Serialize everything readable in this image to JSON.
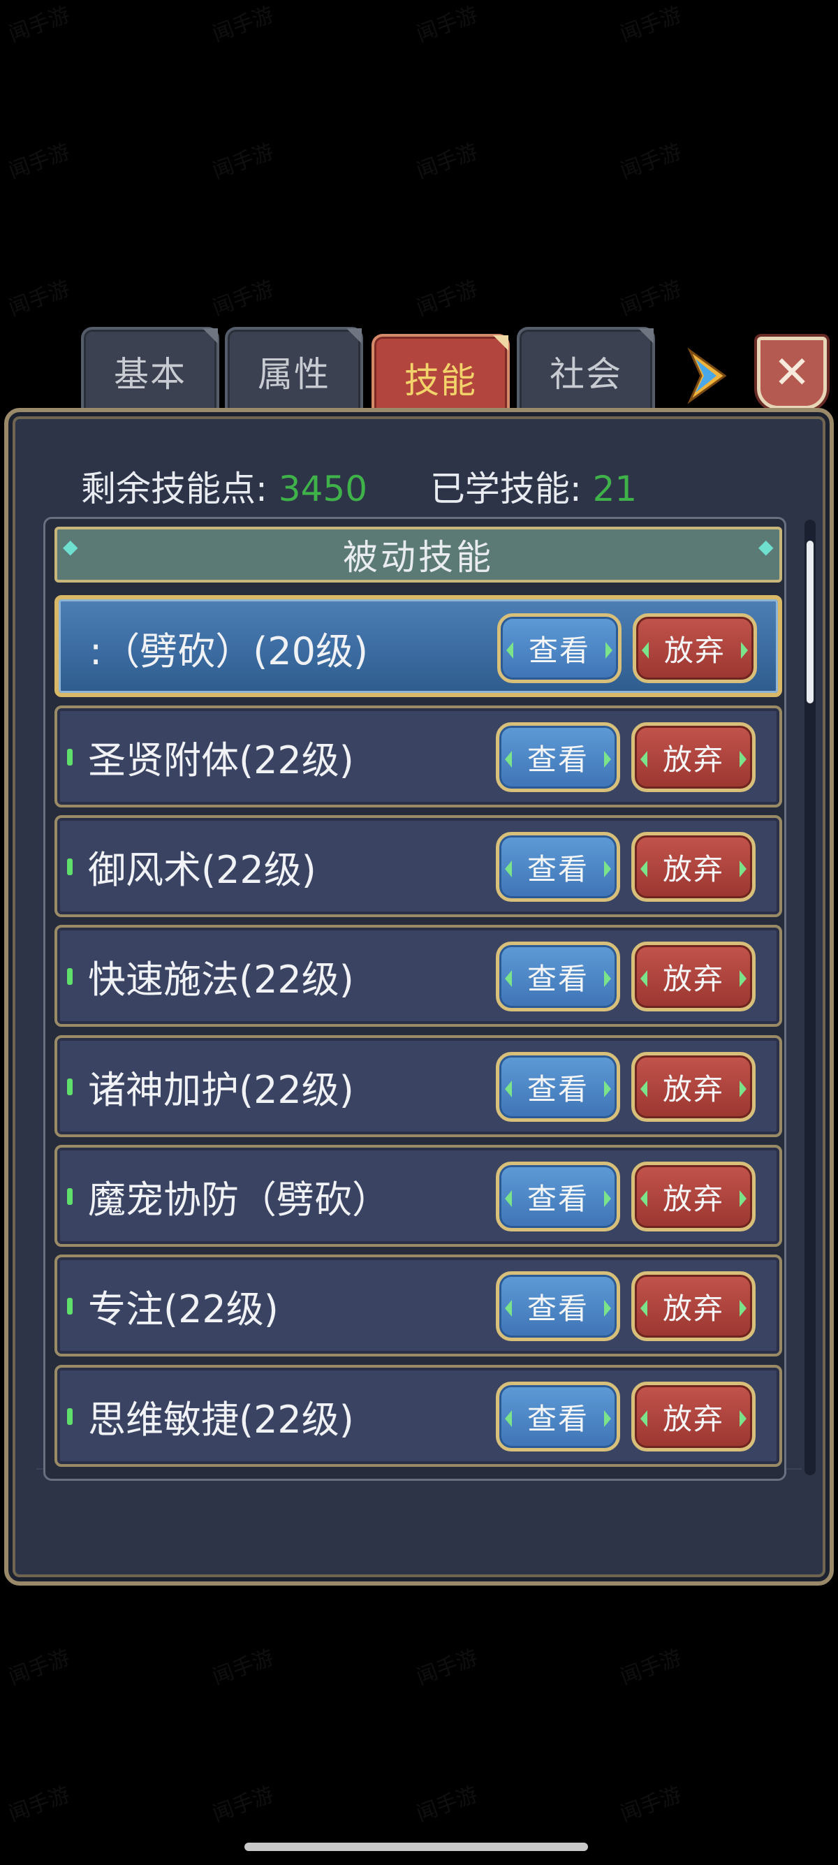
{
  "tabs": [
    {
      "label": "基本",
      "active": false
    },
    {
      "label": "属性",
      "active": false
    },
    {
      "label": "技能",
      "active": true
    },
    {
      "label": "社会",
      "active": false
    }
  ],
  "stats": {
    "remaining_label": "剩余技能点:",
    "remaining_value": "3450",
    "learned_label": "已学技能:",
    "learned_value": "21"
  },
  "section": {
    "title": "被动技能"
  },
  "skills": [
    {
      "name": ":（劈砍）(20级)",
      "view_label": "查看",
      "drop_label": "放弃",
      "selected": true
    },
    {
      "name": "圣贤附体(22级)",
      "view_label": "查看",
      "drop_label": "放弃",
      "selected": false
    },
    {
      "name": "御风术(22级)",
      "view_label": "查看",
      "drop_label": "放弃",
      "selected": false
    },
    {
      "name": "快速施法(22级)",
      "view_label": "查看",
      "drop_label": "放弃",
      "selected": false
    },
    {
      "name": "诸神加护(22级)",
      "view_label": "查看",
      "drop_label": "放弃",
      "selected": false
    },
    {
      "name": "魔宠协防（劈砍）",
      "view_label": "查看",
      "drop_label": "放弃",
      "selected": false
    },
    {
      "name": "专注(22级)",
      "view_label": "查看",
      "drop_label": "放弃",
      "selected": false
    },
    {
      "name": "思维敏捷(22级)",
      "view_label": "查看",
      "drop_label": "放弃",
      "selected": false
    }
  ],
  "scrollbar": {
    "position_fraction": 0.0,
    "visible_fraction": 0.17
  },
  "watermark": "闻手游",
  "colors": {
    "active_tab": "#b2453e",
    "accent_number": "#3fb24a",
    "view_button": "#3f74b6",
    "drop_button": "#9b3630",
    "gold_border": "#d8c07a"
  },
  "icons": {
    "next": "arrow-right-icon",
    "close": "close-icon"
  }
}
